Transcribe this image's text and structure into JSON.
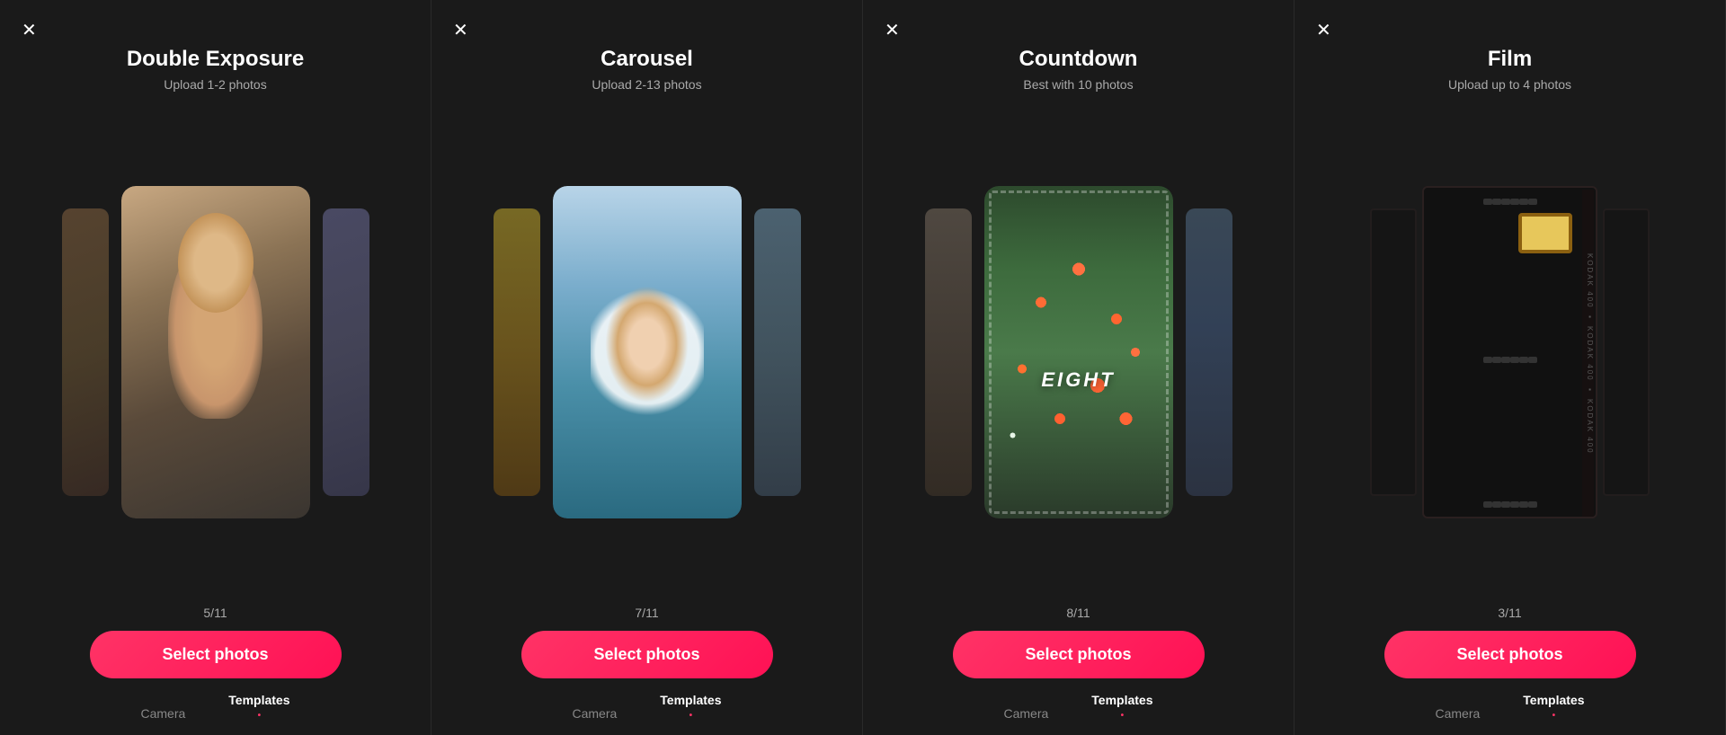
{
  "panels": [
    {
      "id": "double-exposure",
      "title": "Double Exposure",
      "subtitle": "Upload 1-2 photos",
      "counter": "5/11",
      "selectBtn": "Select photos",
      "nav": {
        "camera": "Camera",
        "templates": "Templates",
        "active": "templates"
      }
    },
    {
      "id": "carousel",
      "title": "Carousel",
      "subtitle": "Upload 2-13 photos",
      "counter": "7/11",
      "selectBtn": "Select photos",
      "nav": {
        "camera": "Camera",
        "templates": "Templates",
        "active": "templates"
      }
    },
    {
      "id": "countdown",
      "title": "Countdown",
      "subtitle": "Best with 10 photos",
      "counter": "8/11",
      "selectBtn": "Select photos",
      "nav": {
        "camera": "Camera",
        "templates": "Templates",
        "active": "templates"
      }
    },
    {
      "id": "film",
      "title": "Film",
      "subtitle": "Upload up to 4 photos",
      "counter": "3/11",
      "selectBtn": "Select photos",
      "nav": {
        "camera": "Camera",
        "templates": "Templates",
        "active": "templates"
      }
    }
  ],
  "icons": {
    "close": "✕"
  }
}
